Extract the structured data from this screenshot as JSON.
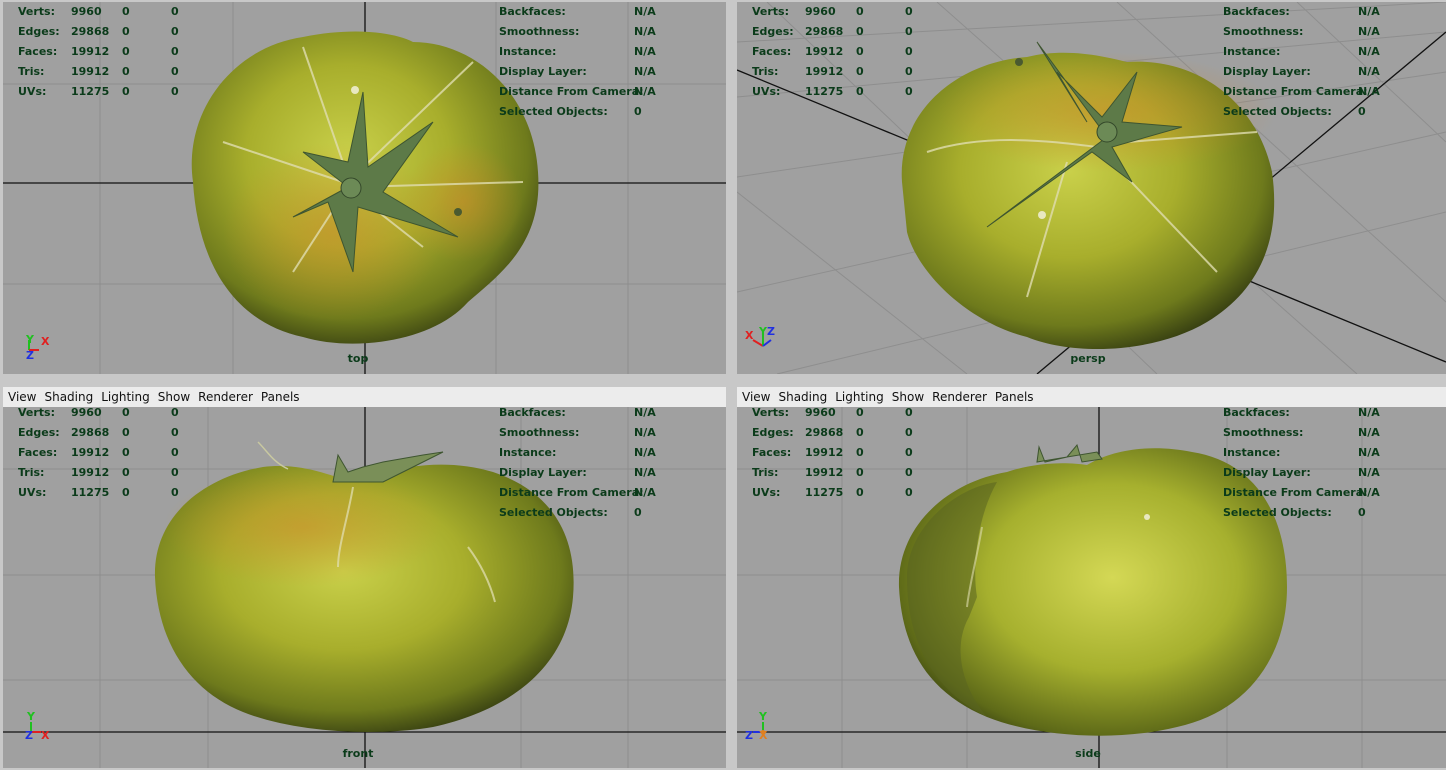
{
  "menu": [
    "View",
    "Shading",
    "Lighting",
    "Show",
    "Renderer",
    "Panels"
  ],
  "hud_left": [
    {
      "label": "Verts:",
      "v1": "9960",
      "v2": "0",
      "v3": "0"
    },
    {
      "label": "Edges:",
      "v1": "29868",
      "v2": "0",
      "v3": "0"
    },
    {
      "label": "Faces:",
      "v1": "19912",
      "v2": "0",
      "v3": "0"
    },
    {
      "label": "Tris:",
      "v1": "19912",
      "v2": "0",
      "v3": "0"
    },
    {
      "label": "UVs:",
      "v1": "11275",
      "v2": "0",
      "v3": "0"
    }
  ],
  "hud_right": [
    {
      "label": "Backfaces:",
      "value": "N/A"
    },
    {
      "label": "Smoothness:",
      "value": "N/A"
    },
    {
      "label": "Instance:",
      "value": "N/A"
    },
    {
      "label": "Display Layer:",
      "value": "N/A"
    },
    {
      "label": "Distance From Camera:",
      "value": "N/A"
    },
    {
      "label": "Selected Objects:",
      "value": "0"
    }
  ],
  "viewports": {
    "top": {
      "camera": "top",
      "axes": [
        "Y",
        "X",
        "Z"
      ]
    },
    "persp": {
      "camera": "persp",
      "axes": [
        "X",
        "Y",
        "Z"
      ]
    },
    "front": {
      "camera": "front",
      "axes": [
        "Y",
        "Z",
        "X"
      ]
    },
    "side": {
      "camera": "side",
      "axes": [
        "Y",
        "Z",
        "X"
      ]
    }
  },
  "colors": {
    "hud_text": "#0b3b1a",
    "viewport_bg": "#a0a0a0",
    "grid": "#8c8c8c",
    "axis_x": "#e02020",
    "axis_y": "#20c020",
    "axis_z": "#2030e0"
  }
}
